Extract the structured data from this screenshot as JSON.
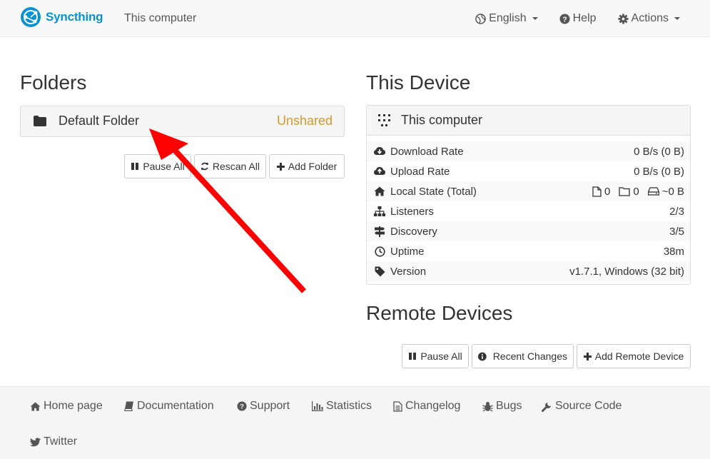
{
  "navbar": {
    "brand": "Syncthing",
    "device_name": "This computer",
    "language": "English",
    "help": "Help",
    "actions": "Actions"
  },
  "folders": {
    "heading": "Folders",
    "items": [
      {
        "name": "Default Folder",
        "status": "Unshared"
      }
    ],
    "buttons": {
      "pause_all": "Pause All",
      "rescan_all": "Rescan All",
      "add_folder": "Add Folder"
    }
  },
  "this_device": {
    "heading": "This Device",
    "name": "This computer",
    "rows": [
      {
        "label": "Download Rate",
        "value": "0 B/s (0 B)",
        "icon": "cloud-download-icon"
      },
      {
        "label": "Upload Rate",
        "value": "0 B/s (0 B)",
        "icon": "cloud-upload-icon"
      },
      {
        "label": "Local State (Total)",
        "files": "0",
        "dirs": "0",
        "size": "~0 B",
        "icon": "home-icon"
      },
      {
        "label": "Listeners",
        "value": "2/3",
        "icon": "sitemap-icon"
      },
      {
        "label": "Discovery",
        "value": "3/5",
        "icon": "signpost-icon"
      },
      {
        "label": "Uptime",
        "value": "38m",
        "icon": "clock-icon"
      },
      {
        "label": "Version",
        "value": "v1.7.1, Windows (32 bit)",
        "icon": "tag-icon"
      }
    ]
  },
  "remote_devices": {
    "heading": "Remote Devices",
    "buttons": {
      "pause_all": "Pause All",
      "recent_changes": "Recent Changes",
      "add_remote_device": "Add Remote Device"
    }
  },
  "footer": {
    "links": [
      "Home page",
      "Documentation",
      "Support",
      "Statistics",
      "Changelog",
      "Bugs",
      "Source Code",
      "Twitter"
    ]
  },
  "colors": {
    "brand": "#0891d1",
    "unshared": "#d39a2c",
    "annotation_arrow": "#ff0000"
  }
}
